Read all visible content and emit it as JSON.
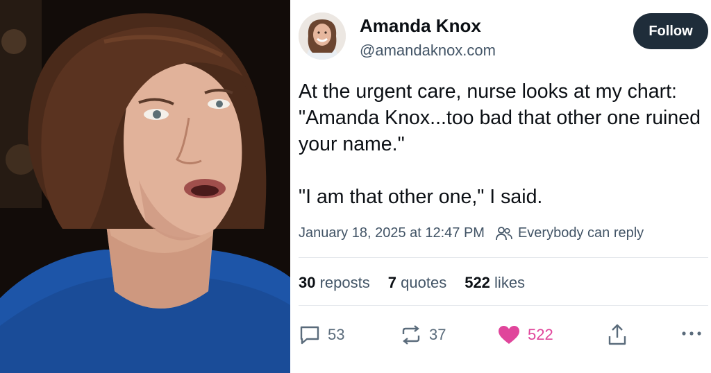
{
  "photo": {
    "icon": "portrait-photo"
  },
  "post": {
    "author": {
      "name": "Amanda Knox",
      "handle": "@amandaknox.com",
      "avatar_icon": "avatar"
    },
    "follow_label": "Follow",
    "text": {
      "paragraph1": "At the urgent care, nurse looks at my chart: \"Amanda Knox...too bad that other one ruined your name.\"",
      "paragraph2": "\"I am that other one,\" I said."
    },
    "timestamp": "January 18, 2025 at 12:47 PM",
    "reply_setting": "Everybody can reply",
    "stats": {
      "reposts_count": "30",
      "reposts_label": "reposts",
      "quotes_count": "7",
      "quotes_label": "quotes",
      "likes_count": "522",
      "likes_label": "likes"
    },
    "actions": {
      "reply_count": "53",
      "repost_count": "37",
      "like_count": "522"
    }
  },
  "colors": {
    "like": "#e0459b",
    "follow_bg": "#1f2d3a",
    "muted_text": "#425466"
  }
}
